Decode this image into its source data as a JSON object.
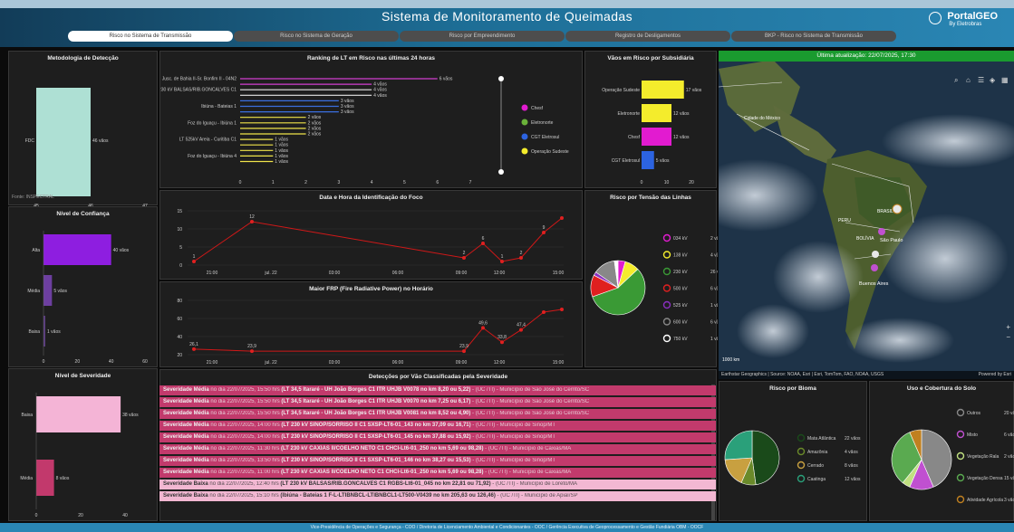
{
  "header": {
    "title": "Sistema de Monitoramento de Queimadas",
    "logo": "PortalGEO",
    "logo_sub": "By Eletrobras"
  },
  "tabs": [
    {
      "label": "Risco no Sistema de Transmissão",
      "active": true
    },
    {
      "label": "Risco no Sistema de Geração"
    },
    {
      "label": "Risco por Empreendimento"
    },
    {
      "label": "Registro de Desligamentos"
    },
    {
      "label": "BKP - Risco no Sistema de Transmissão"
    }
  ],
  "metodologia": {
    "title": "Metodologia de Detecção",
    "category": "FDC",
    "bar_label": "46 vãos",
    "value": 46,
    "xlim": [
      45,
      47
    ],
    "ticks": [
      "45",
      "46",
      "47"
    ],
    "source": "Fonte: INSPECTRAL"
  },
  "confianca": {
    "title": "Nível de Confiança",
    "categories": [
      "Alta",
      "Média",
      "Baixa"
    ],
    "values": [
      40,
      5,
      1
    ],
    "labels": [
      "40 vãos",
      "5 vãos",
      "1 vãos"
    ],
    "ticks": [
      "0",
      "20",
      "40",
      "60"
    ],
    "colors": [
      "#8e1ee0",
      "#6d3fa0",
      "#5a3c80"
    ]
  },
  "severidade": {
    "title": "Nível de Severidade",
    "categories": [
      "Baixa",
      "Média"
    ],
    "values": [
      38,
      8
    ],
    "labels": [
      "38 vãos",
      "8 vãos"
    ],
    "ticks": [
      "0",
      "20",
      "40"
    ],
    "colors": [
      "#f4b4d6",
      "#c2396c"
    ]
  },
  "ranking": {
    "title": "Ranking de LT em Risco nas últimas 24 horas",
    "rows": [
      {
        "label": "Jusc. de Bahia II-Sr. Bonfim II - 04N2",
        "value": 6,
        "text": "6 vãos",
        "color": "#d13fd0"
      },
      {
        "label": "",
        "value": 4,
        "text": "4 vãos",
        "color": "#d13fd0"
      },
      {
        "label": "LT 230 kV BALSAS/RIB.GONCALVES C1",
        "value": 4,
        "text": "4 vãos",
        "color": "#e6e6e6"
      },
      {
        "label": "",
        "value": 4,
        "text": "4 vãos",
        "color": "#e6e6e6"
      },
      {
        "label": "",
        "value": 3,
        "text": "3 vãos",
        "color": "#3a6ee0"
      },
      {
        "label": "Ibiúna - Bateias 1",
        "value": 3,
        "text": "3 vãos",
        "color": "#3a6ee0"
      },
      {
        "label": "",
        "value": 3,
        "text": "3 vãos",
        "color": "#3a6ee0"
      },
      {
        "label": "",
        "value": 2,
        "text": "2 vãos",
        "color": "#f0e44a"
      },
      {
        "label": "Foz do Iguaçu - Ibiúna 1",
        "value": 2,
        "text": "2 vãos",
        "color": "#f0e44a"
      },
      {
        "label": "",
        "value": 2,
        "text": "2 vãos",
        "color": "#f0e44a"
      },
      {
        "label": "",
        "value": 2,
        "text": "2 vãos",
        "color": "#f0e44a"
      },
      {
        "label": "LT 525kV Areia - Curitiba C1",
        "value": 1,
        "text": "1 vãos",
        "color": "#f0e44a"
      },
      {
        "label": "",
        "value": 1,
        "text": "1 vãos",
        "color": "#f0e44a"
      },
      {
        "label": "",
        "value": 1,
        "text": "1 vãos",
        "color": "#f0e44a"
      },
      {
        "label": "Foz do Iguaçu - Ibiúna 4",
        "value": 1,
        "text": "1 vãos",
        "color": "#f0e44a"
      },
      {
        "label": "",
        "value": 1,
        "text": "1 vãos",
        "color": "#f0e44a"
      }
    ],
    "ticks": [
      "0",
      "1",
      "2",
      "3",
      "4",
      "5",
      "6",
      "7"
    ],
    "legend": [
      {
        "name": "Chesf",
        "color": "#e21bd0"
      },
      {
        "name": "Eletronorte",
        "color": "#6ab23a"
      },
      {
        "name": "CGT Eletrosul",
        "color": "#2c63e0"
      },
      {
        "name": "Operação Sudeste",
        "color": "#f4ec2c"
      }
    ]
  },
  "subsidiaria": {
    "title": "Vãos em Risco por Subsidiária",
    "categories": [
      "Operação Sudeste",
      "Eletronorte",
      "Chesf",
      "CGT Eletrosul"
    ],
    "values": [
      17,
      12,
      12,
      5
    ],
    "labels": [
      "17 vãos",
      "12 vãos",
      "12 vãos",
      "5 vãos"
    ],
    "colors": [
      "#f4ec2c",
      "#f4ec2c",
      "#e21bd0",
      "#2c63e0"
    ],
    "ticks": [
      "0",
      "10",
      "20"
    ]
  },
  "timeline": {
    "title": "Data e Hora da Identificação do Foco",
    "y_ticks": [
      "0",
      "5",
      "10",
      "15"
    ],
    "x_ticks": [
      "21:00",
      "jul. 22",
      "03:00",
      "06:00",
      "09:00",
      "12:00",
      "15:00"
    ],
    "points": [
      1,
      12,
      2,
      6,
      1,
      2,
      9,
      13
    ],
    "point_labels": [
      "1",
      "12",
      "2",
      "6",
      "1",
      "2",
      "9",
      ""
    ]
  },
  "frp": {
    "title": "Maior FRP (Fire Radiative Power) no  Horário",
    "y_ticks": [
      "20",
      "40",
      "60",
      "80"
    ],
    "x_ticks": [
      "21:00",
      "jul. 22",
      "03:00",
      "06:00",
      "09:00",
      "12:00",
      "15:00"
    ],
    "points": [
      26.1,
      23.9,
      23.9,
      49.6,
      33.8,
      47.4,
      67,
      70
    ],
    "point_labels": [
      "26,1",
      "23,9",
      "23,9",
      "49,6",
      "33,8",
      "47,4",
      "",
      ""
    ]
  },
  "tensao": {
    "title": "Risco por Tensão das Linhas",
    "legend": [
      {
        "name": "034 kV",
        "text": "2 vãos",
        "color": "#e21bd0",
        "value": 2
      },
      {
        "name": "138 kV",
        "text": "4 vãos",
        "color": "#f4ec2c",
        "value": 4
      },
      {
        "name": "230 kV",
        "text": "26 vãos",
        "color": "#3a9a35",
        "value": 26
      },
      {
        "name": "500 kV",
        "text": "6 vãos",
        "color": "#e02020",
        "value": 6
      },
      {
        "name": "525 kV",
        "text": "1 vãos",
        "color": "#8a2fc0",
        "value": 1
      },
      {
        "name": "600 kV",
        "text": "6 vãos",
        "color": "#888888",
        "value": 6
      },
      {
        "name": "750 kV",
        "text": "1 vãos",
        "color": "#ffffff",
        "value": 1
      }
    ]
  },
  "deteccoes": {
    "title": "Detecções por Vão Classificadas pela Severidade",
    "rows": [
      {
        "sev": "Severidade Média",
        "date": " no dia 22/07/2025, 15:50 hrs",
        "line": " (LT 34,5 Itararé - UH João Borges C1 ITR UHJB V0078 no km 8,20 ou 5,22)",
        "loc": " - (UC /TI) - Município de São José do Cerrito/SC",
        "level": "med"
      },
      {
        "sev": "Severidade Média",
        "date": " no dia 22/07/2025, 15:50 hrs",
        "line": " (LT 34,5 Itararé - UH João Borges C1 ITR UHJB V0070 no km 7,25 ou 6,17)",
        "loc": " - (UC /TI) - Município de São José do Cerrito/SC",
        "level": "med"
      },
      {
        "sev": "Severidade Média",
        "date": " no dia 22/07/2025, 15:50 hrs",
        "line": " (LT 34,5 Itararé - UH João Borges C1 ITR UHJB V0081 no km 8,52 ou 4,90)",
        "loc": " - (UC /TI) - Município de São José do Cerrito/SC",
        "level": "med"
      },
      {
        "sev": "Severidade Média",
        "date": " no dia 22/07/2025, 14:00 hrs",
        "line": " (LT 230 kV SINOP/SORRISO II C1 SXSP-LT6-01_143 no km 37,09 ou 16,71)",
        "loc": " - (UC /TI) - Município de Sinop/MT",
        "level": "med"
      },
      {
        "sev": "Severidade Média",
        "date": " no dia 22/07/2025, 14:00 hrs",
        "line": " (LT 230 kV SINOP/SORRISO II C1 SXSP-LT6-01_145 no km 37,88 ou 15,92)",
        "loc": " - (UC /TI) - Município de Sinop/MT",
        "level": "med"
      },
      {
        "sev": "Severidade Média",
        "date": " no dia 22/07/2025, 11:30 hrs",
        "line": " (LT 230 kV CAXIAS II/COELHO NETO C1 CHCI-Lt6-01_250 no km 5,69 ou 98,28)",
        "loc": " - (UC /TI) - Município de Caxias/MA",
        "level": "med"
      },
      {
        "sev": "Severidade Média",
        "date": " no dia 22/07/2025, 13:50 hrs",
        "line": " (LT 230 kV SINOP/SORRISO II C1 SXSP-LT6-01_146 no km 38,27 ou 15,53)",
        "loc": " - (UC /TI) - Município de Sinop/MT",
        "level": "med"
      },
      {
        "sev": "Severidade Média",
        "date": " no dia 22/07/2025, 11:00 hrs",
        "line": " (LT 230 kV CAXIAS II/COELHO NETO C1 CHCI-Lt6-01_250 no km 5,69 ou 98,28)",
        "loc": " - (UC /TI) - Município de Caxias/MA",
        "level": "med"
      },
      {
        "sev": "Severidade Baixa",
        "date": " no dia 22/07/2025, 12:40 hrs",
        "line": " (LT 230 kV BALSAS/RIB.GONCALVES C1 RGBS-Lt6-01_045 no km 22,81 ou 71,92)",
        "loc": " - (UC /TI) - Município de Loreto/MA",
        "level": "low"
      },
      {
        "sev": "Severidade Baixa",
        "date": " no dia 22/07/2025, 15:10 hrs",
        "line": " (Ibiúna - Bateias 1 F-L-LTIBNBCL-LTIBNBCL1-LT500-V0439 no km 205,63 ou 126,46)",
        "loc": " - (UC /TI) - Município de Apiaí/SP",
        "level": "low"
      }
    ]
  },
  "map": {
    "updated": "Última atualização: 22/07/2025, 17:30",
    "attribution": "Earthstar Geographics | Source: NOAA, Esri | Esri, TomTom, FAO, NOAA, USGS",
    "powered": "Powered by Esri",
    "scale": "1000 km",
    "labels": [
      "Cidade do México",
      "São Paulo",
      "Buenos Aires",
      "BRASIL",
      "PERU",
      "BOLÍVIA"
    ]
  },
  "bioma": {
    "title": "Risco por Bioma",
    "legend": [
      {
        "name": "Mata Atlântica",
        "text": "22 vãos",
        "color": "#1a4a1a",
        "value": 22
      },
      {
        "name": "Amazônia",
        "text": "4 vãos",
        "color": "#6a8a2a",
        "value": 4
      },
      {
        "name": "Cerrado",
        "text": "8 vãos",
        "color": "#c8a040",
        "value": 8
      },
      {
        "name": "Caatinga",
        "text": "12 vãos",
        "color": "#2aa07a",
        "value": 12
      }
    ]
  },
  "solo": {
    "title": "Uso e Cobertura do Solo",
    "legend": [
      {
        "name": "Outros",
        "text": "20 vãos",
        "color": "#888888",
        "value": 20
      },
      {
        "name": "Misto",
        "text": "6 vãos",
        "color": "#c050d0",
        "value": 6
      },
      {
        "name": "Vegetação Rala",
        "text": "2 vãos",
        "color": "#c0e080",
        "value": 2
      },
      {
        "name": "Vegetação Densa",
        "text": "15 vãos",
        "color": "#5aaa50",
        "value": 15
      },
      {
        "name": "Atividade Agrícola",
        "text": "3 vãos",
        "color": "#c08020",
        "value": 3
      }
    ]
  },
  "footer": "Vice-Presidência de Operações e Segurança - COO / Diretoria de Licenciamento Ambiental e Condicionantes - OOC / Gerência Executiva de Geoprocessamento e Gestão Fundiária OBM - OOCF"
}
